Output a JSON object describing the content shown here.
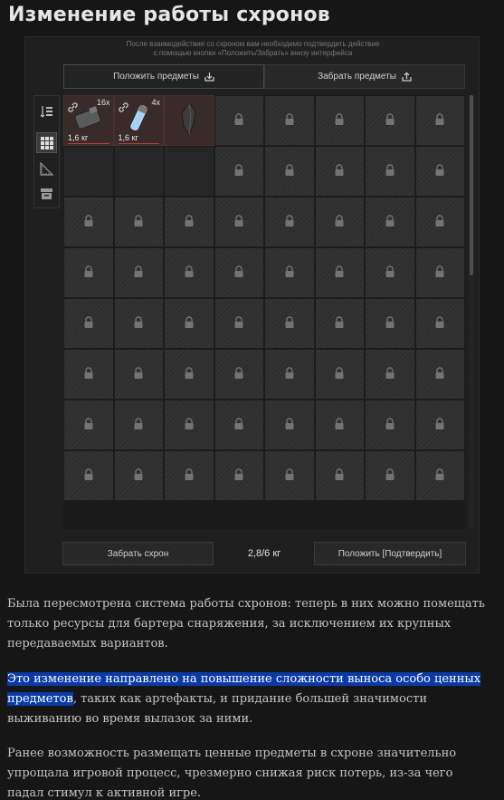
{
  "page": {
    "title": "Изменение работы схронов"
  },
  "stash": {
    "notice_line1": "После взаимодействия со схроном вам необходимо подтвердить действие",
    "notice_line2": "с помощью кнопки «Положить/Забрать» внизу интерфейса",
    "tabs": [
      {
        "label": "Положить предметы",
        "icon": "download-tray-icon",
        "active": true
      },
      {
        "label": "Забрать предметы",
        "icon": "upload-tray-icon",
        "active": false
      }
    ],
    "sidebar_icons": [
      "sort-icon",
      "grid-icon",
      "ruler-icon",
      "archive-box-icon"
    ],
    "items": [
      {
        "qty": "16x",
        "weight": "1,6 кг",
        "icon": "battery-icon"
      },
      {
        "qty": "4x",
        "weight": "1,6 кг",
        "icon": "vial-icon"
      },
      {
        "qty": "",
        "weight": "",
        "icon": "crystal-artifact-icon"
      }
    ],
    "footer": {
      "take_stash": "Забрать схрон",
      "weight": "2,8/6 кг",
      "confirm": "Положить [Подтвердить]"
    }
  },
  "article": {
    "p1": "Была пересмотрена система работы схронов: теперь в них можно помещать только ресурсы для бартера снаряжения, за исключением их крупных передаваемых вариантов.",
    "p2_highlight": "Это изменение направлено на повышение сложности выноса особо ценных предметов",
    "p2_rest": ", таких как артефакты, и придание большей значимости выживанию во время вылазок за ними.",
    "p3": "Ранее возможность размещать ценные предметы в схроне значительно упрощала игровой процесс, чрезмерно снижая риск потерь, из-за чего падал стимул к активной игре."
  }
}
